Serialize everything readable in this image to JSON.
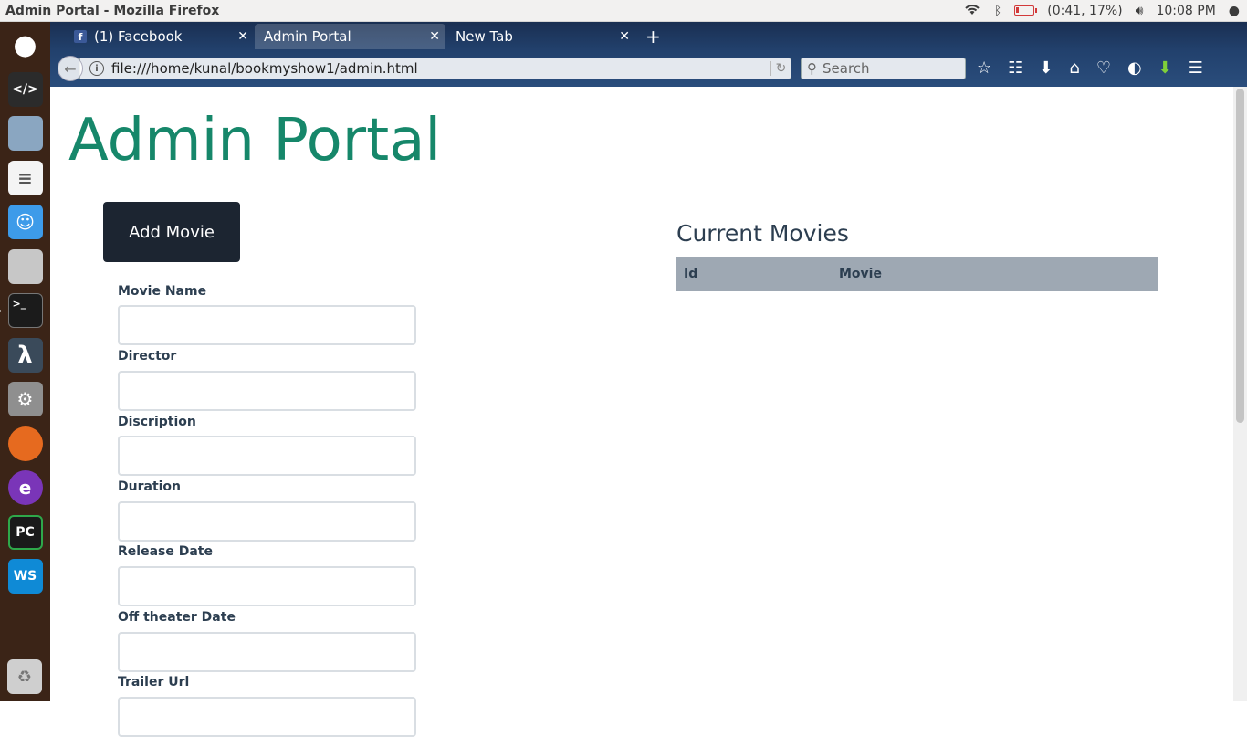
{
  "window": {
    "title": "Admin Portal - Mozilla Firefox"
  },
  "system_tray": {
    "battery": "(0:41, 17%)",
    "battery_percent": 17,
    "time": "10:08 PM"
  },
  "tabs": [
    {
      "label": "(1) Facebook",
      "icon": "facebook-icon"
    },
    {
      "label": "Admin Portal",
      "active": true
    },
    {
      "label": "New Tab"
    }
  ],
  "navbar": {
    "url": "file:///home/kunal/bookmyshow1/admin.html",
    "search_placeholder": "Search"
  },
  "page": {
    "title": "Admin Portal",
    "add_button": "Add Movie",
    "fields": [
      {
        "label": "Movie Name",
        "value": ""
      },
      {
        "label": "Director",
        "value": ""
      },
      {
        "label": "Discription",
        "value": ""
      },
      {
        "label": "Duration",
        "value": ""
      },
      {
        "label": "Release Date",
        "value": ""
      },
      {
        "label": "Off theater Date",
        "value": ""
      },
      {
        "label": "Trailer Url",
        "value": ""
      }
    ],
    "current_movies": {
      "title": "Current Movies",
      "columns": [
        "Id",
        "Movie"
      ]
    }
  },
  "colors": {
    "title": "#16876a",
    "button": "#1c2531",
    "table_header": "#9ea8b3",
    "launcher": "#3b2417"
  }
}
